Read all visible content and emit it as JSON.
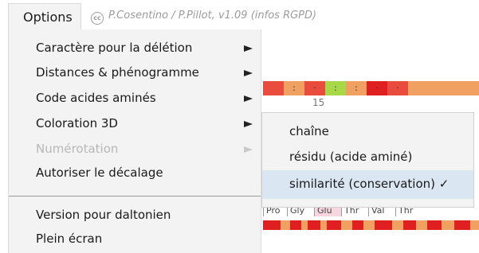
{
  "menubar": {
    "menu_label": "Options",
    "credit_icon": "cc",
    "credit_text": "P.Cosentino / P.Pillot, v1.09 (infos RGPD)"
  },
  "background": {
    "position_number": "15",
    "strip_colors": [
      "#f0a060",
      "#e94b3c",
      "#e02020",
      "#a8d848"
    ],
    "aa_labels": [
      "Pro",
      "Gly",
      "Glu",
      "Thr",
      "Val",
      "Thr"
    ]
  },
  "menu": {
    "items": [
      {
        "label": "Caractère pour la délétion",
        "has_submenu": true,
        "disabled": false
      },
      {
        "label": "Distances & phénogramme",
        "has_submenu": true,
        "disabled": false
      },
      {
        "label": "Code acides aminés",
        "has_submenu": true,
        "disabled": false
      },
      {
        "label": "Coloration 3D",
        "has_submenu": true,
        "disabled": false
      },
      {
        "label": "Numérotation",
        "has_submenu": true,
        "disabled": true
      },
      {
        "label": "Autoriser le décalage",
        "has_submenu": false,
        "disabled": false
      },
      {
        "label": "Version pour daltonien",
        "has_submenu": false,
        "disabled": false
      },
      {
        "label": "Plein écran",
        "has_submenu": false,
        "disabled": false
      }
    ]
  },
  "submenu": {
    "items": [
      {
        "label": "chaîne",
        "checked": false
      },
      {
        "label": "résidu (acide aminé)",
        "checked": false
      },
      {
        "label": "similarité (conservation) ✓",
        "checked": true
      }
    ]
  }
}
